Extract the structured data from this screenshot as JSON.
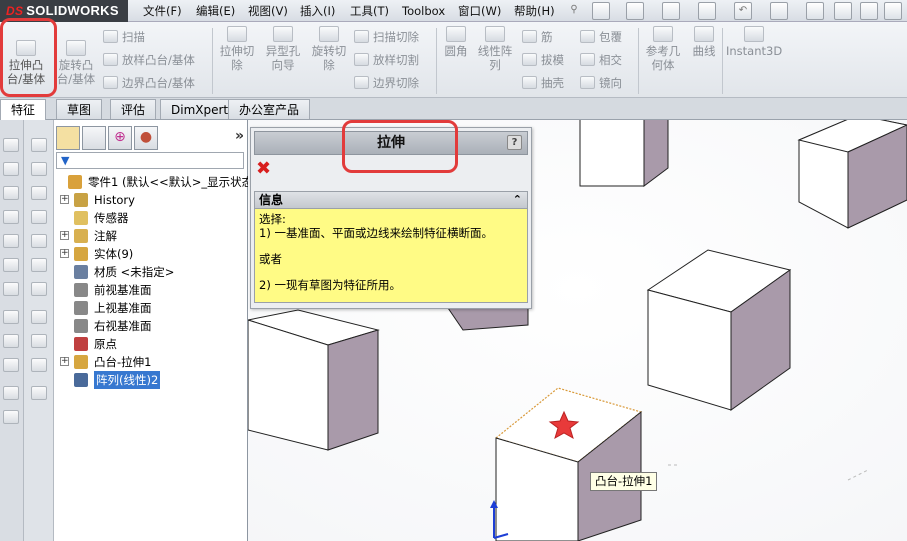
{
  "app": {
    "logo_prefix": "DS",
    "logo_text": "SOLIDWORKS"
  },
  "menu": [
    "文件(F)",
    "编辑(E)",
    "视图(V)",
    "插入(I)",
    "工具(T)",
    "Toolbox",
    "窗口(W)",
    "帮助(H)"
  ],
  "ribbon": {
    "extrude_boss": "拉伸凸\n台/基体",
    "revolve_boss": "旋转凸\n台/基体",
    "sweep": "扫描",
    "loft_boss": "放样凸台/基体",
    "boundary_boss": "边界凸台/基体",
    "extrude_cut": "拉伸切\n除",
    "hole_wizard": "异型孔\n向导",
    "revolve_cut": "旋转切\n除",
    "swept_cut": "扫描切除",
    "lofted_cut": "放样切割",
    "boundary_cut": "边界切除",
    "fillet": "圆角",
    "linear_pattern": "线性阵\n列",
    "rib": "筋",
    "draft": "拔模",
    "shell": "抽壳",
    "wrap": "包覆",
    "intersect": "相交",
    "mirror": "镜向",
    "ref_geometry": "参考几\n何体",
    "curves": "曲线",
    "instant3d": "Instant3D"
  },
  "tabs": [
    "特征",
    "草图",
    "评估",
    "DimXpert",
    "办公室产品"
  ],
  "tabs_active": 0,
  "feature_tree": {
    "more": "»",
    "items": [
      {
        "label": "零件1 (默认<<默认>_显示状态",
        "expander": "",
        "icon": "part-icon",
        "color": "#d9a13b"
      },
      {
        "label": "History",
        "expander": "+",
        "icon": "history-icon",
        "color": "#c8a244"
      },
      {
        "label": "传感器",
        "expander": "",
        "icon": "sensor-icon",
        "color": "#e0c060"
      },
      {
        "label": "注解",
        "expander": "+",
        "icon": "annotations-icon",
        "color": "#d8b050"
      },
      {
        "label": "实体(9)",
        "expander": "+",
        "icon": "solid-bodies-icon",
        "color": "#d6a640"
      },
      {
        "label": "材质 <未指定>",
        "expander": "",
        "icon": "material-icon",
        "color": "#6a7fa0"
      },
      {
        "label": "前视基准面",
        "expander": "",
        "icon": "plane-icon",
        "color": "#888"
      },
      {
        "label": "上视基准面",
        "expander": "",
        "icon": "plane-icon",
        "color": "#888"
      },
      {
        "label": "右视基准面",
        "expander": "",
        "icon": "plane-icon",
        "color": "#888"
      },
      {
        "label": "原点",
        "expander": "",
        "icon": "origin-icon",
        "color": "#c04040"
      },
      {
        "label": "凸台-拉伸1",
        "expander": "+",
        "icon": "extrude-icon",
        "color": "#d6a640"
      },
      {
        "label": "阵列(线性)2",
        "expander": "",
        "icon": "linear-pattern-icon",
        "color": "#4a6a9a"
      }
    ],
    "selected_index": 11
  },
  "property_manager": {
    "title": "拉伸",
    "help": "?",
    "cancel": "✖",
    "info_header": "信息",
    "info_collapse": "⌃",
    "info_lines": [
      "选择:",
      "1) 一基准面、平面或边线来绘制特征横断面。",
      "",
      "或者",
      "",
      "2) 一现有草图为特征所用。"
    ]
  },
  "tooltip": "凸台-拉伸1",
  "colors": {
    "highlight_red": "#e23b3b",
    "info_yellow": "#fffb85",
    "cube_side": "#a899a8",
    "selected_edge": "#d99a3a"
  }
}
